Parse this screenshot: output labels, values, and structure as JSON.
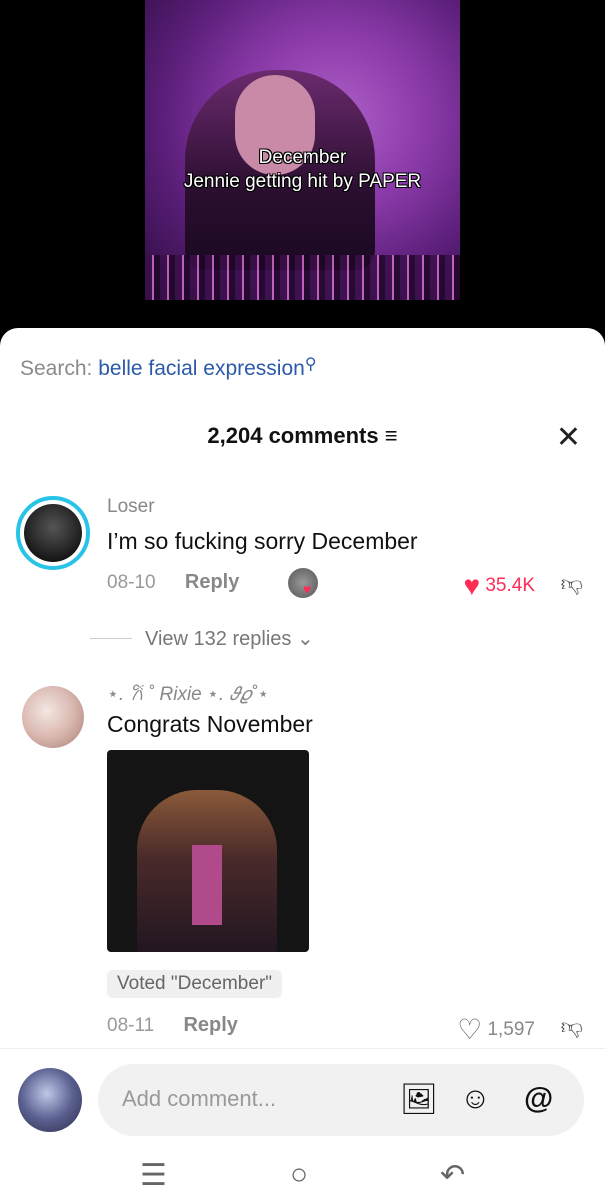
{
  "video": {
    "caption_line1": "December",
    "caption_line2": "Jennie getting hit by PAPER"
  },
  "search": {
    "label": "Search:",
    "query": "belle facial expression",
    "icon": "search-icon"
  },
  "comments_header": {
    "count_label": "2,204 comments",
    "filter_icon": "≡",
    "close_icon": "✕"
  },
  "comments": [
    {
      "username": "Loser",
      "text": "I’m so fucking sorry December",
      "date": "08-10",
      "reply_label": "Reply",
      "likes": "35.4K",
      "liked": true,
      "view_replies": "View 132 replies ⌄"
    },
    {
      "username": "⋆. 𐙚 ˚ Rixie ⋆. 𝜗𝜚˚⋆",
      "text": "Congrats November",
      "date": "08-11",
      "reply_label": "Reply",
      "likes": "1,597",
      "liked": false,
      "vote_label": "Voted \"December\""
    }
  ],
  "composer": {
    "placeholder": "Add comment...",
    "icons": [
      "image-icon",
      "sticker-icon",
      "mention-icon"
    ],
    "mention_glyph": "@"
  },
  "system_nav": {
    "icons": [
      "recents-icon",
      "home-icon",
      "back-icon"
    ]
  },
  "colors": {
    "accent_red": "#fe2c55",
    "search_blue": "#2b5aa8",
    "story_ring": "#27c4e8"
  }
}
